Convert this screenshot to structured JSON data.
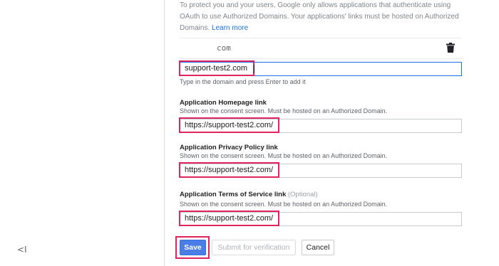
{
  "sidebar": {
    "collapse_icon_glyph": "<I"
  },
  "intro": {
    "text": "To protect you and your users, Google only allows applications that authenticate using OAuth to use Authorized Domains. Your applications' links must be hosted on Authorized Domains.",
    "learn_more": "Learn more"
  },
  "authorized_domains": {
    "items": [
      {
        "domain": "com"
      }
    ],
    "new_domain_value": "support-test2.com",
    "new_domain_hint": "Type in the domain and press Enter to add it"
  },
  "homepage": {
    "label": "Application Homepage link",
    "sub": "Shown on the consent screen. Must be hosted on an Authorized Domain.",
    "value": "https://support-test2.com/"
  },
  "privacy": {
    "label": "Application Privacy Policy link",
    "sub": "Shown on the consent screen. Must be hosted on an Authorized Domain.",
    "value": "https://support-test2.com/"
  },
  "terms": {
    "label": "Application Terms of Service link",
    "optional": "(Optional)",
    "sub": "Shown on the consent screen. Must be hosted on an Authorized Domain.",
    "value": "https://support-test2.com/"
  },
  "actions": {
    "save": "Save",
    "submit": "Submit for verification",
    "cancel": "Cancel"
  },
  "colors": {
    "highlight": "#e0245e",
    "link": "#1a73e8",
    "primary": "#4a7de8"
  }
}
